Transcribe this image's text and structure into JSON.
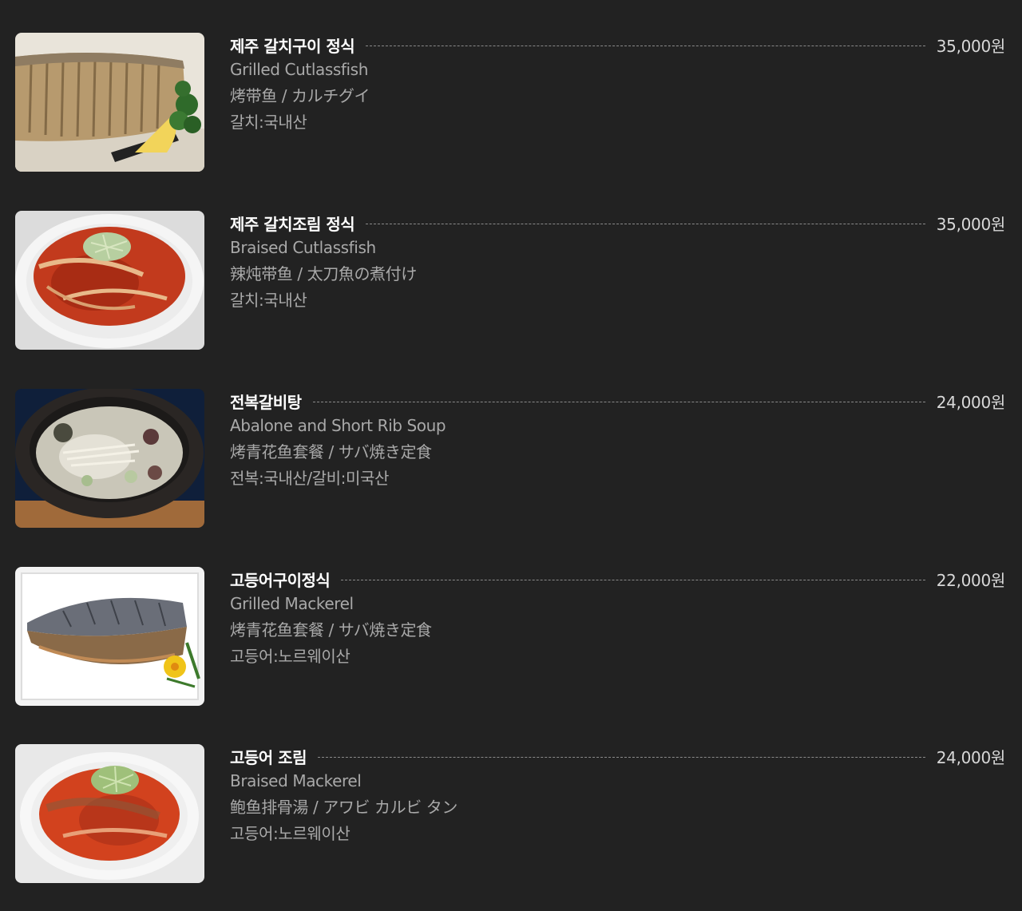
{
  "menu": {
    "items": [
      {
        "name_ko": "제주 갈치구이 정식",
        "name_en": "Grilled Cutlassfish",
        "name_cn_jp": "烤带鱼 / カルチグイ",
        "origin": "갈치:국내산",
        "price": "35,000원",
        "image": "grilled-cutlassfish-photo"
      },
      {
        "name_ko": "제주 갈치조림 정식",
        "name_en": "Braised Cutlassfish",
        "name_cn_jp": "辣炖带鱼 / 太刀魚の煮付け",
        "origin": "갈치:국내산",
        "price": "35,000원",
        "image": "braised-cutlassfish-photo"
      },
      {
        "name_ko": "전복갈비탕",
        "name_en": "Abalone and Short Rib Soup",
        "name_cn_jp": "烤青花鱼套餐 / サバ焼き定食",
        "origin": "전복:국내산/갈비:미국산",
        "price": "24,000원",
        "image": "abalone-short-rib-soup-photo"
      },
      {
        "name_ko": "고등어구이정식",
        "name_en": "Grilled Mackerel",
        "name_cn_jp": "烤青花鱼套餐 / サバ焼き定食",
        "origin": "고등어:노르웨이산",
        "price": "22,000원",
        "image": "grilled-mackerel-photo"
      },
      {
        "name_ko": "고등어 조림",
        "name_en": "Braised Mackerel",
        "name_cn_jp": "鲍鱼排骨湯 / アワビ カルビ タン",
        "origin": "고등어:노르웨이산",
        "price": "24,000원",
        "image": "braised-mackerel-photo"
      }
    ]
  },
  "colors": {
    "background": "#222222",
    "title": "#ffffff",
    "text": "#a9a9a9",
    "leader": "#8a8a8a"
  }
}
